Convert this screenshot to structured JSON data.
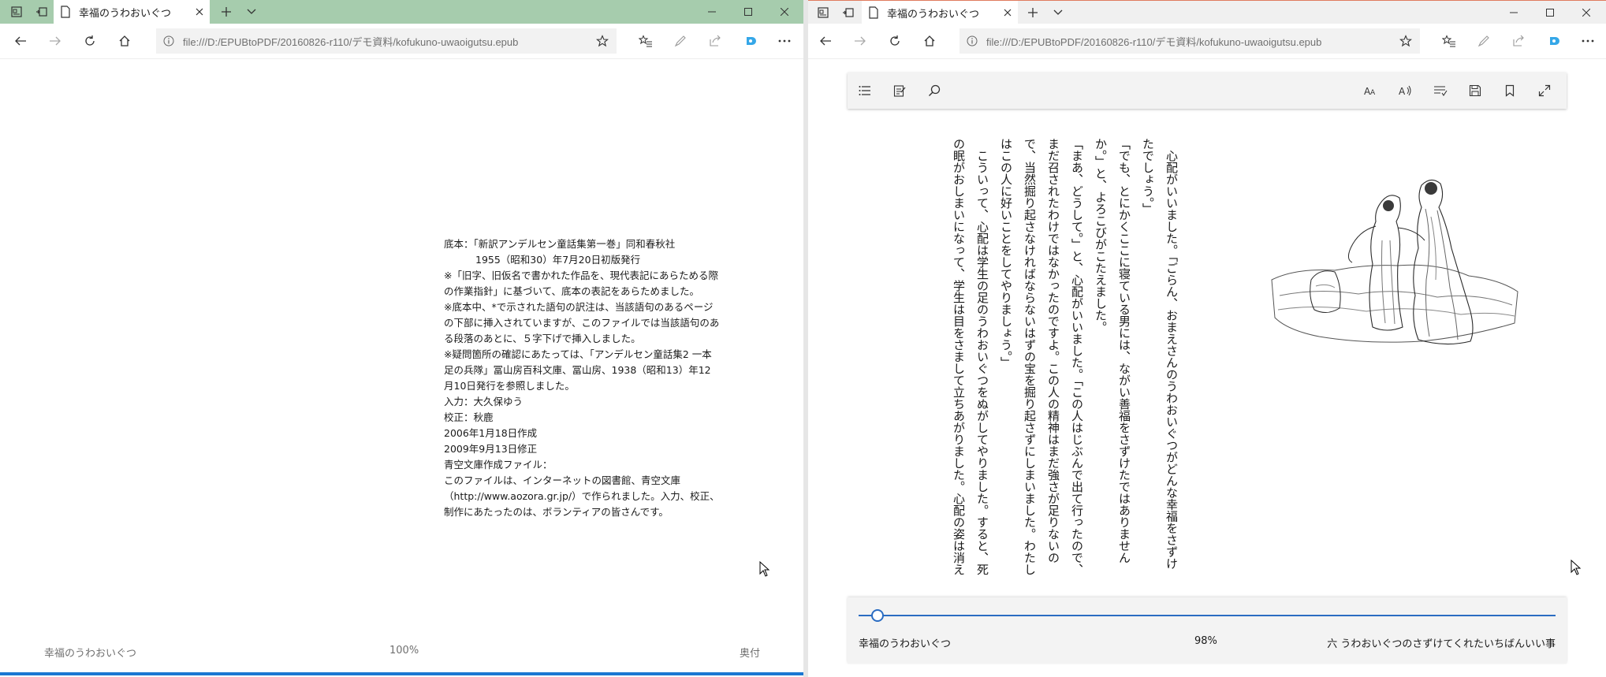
{
  "left_window": {
    "tab_title": "幸福のうわおいぐつ",
    "address": "file:///D:/EPUBtoPDF/20160826-r110/デモ資料/kofukuno-uwaoigutsu.epub",
    "colophon": [
      "底本：「新訳アンデルセン童話集第一巻」同和春秋社",
      "1955（昭和30）年7月20日初版発行",
      "※「旧字、旧仮名で書かれた作品を、現代表記にあらためる際の作業指針」に基づいて、底本の表記をあらためました。",
      "※底本中、*で示された語句の訳注は、当該語句のあるページの下部に挿入されていますが、このファイルでは当該語句のある段落のあとに、５字下げで挿入しました。",
      "※疑問箇所の確認にあたっては、「アンデルセン童話集2 一本足の兵隊」冨山房百科文庫、冨山房、1938（昭和13）年12月10日発行を参照しました。",
      "入力：大久保ゆう",
      "校正：秋鹿",
      "2006年1月18日作成",
      "2009年9月13日修正",
      "青空文庫作成ファイル：",
      "このファイルは、インターネットの図書館、青空文庫（http://www.aozora.gr.jp/）で作られました。入力、校正、制作にあたったのは、ボランティアの皆さんです。"
    ],
    "footer": {
      "book_title": "幸福のうわおいぐつ",
      "progress": "100%",
      "section": "奥付"
    },
    "progress_value": 1.0
  },
  "right_window": {
    "tab_title": "幸福のうわおいぐつ",
    "address": "file:///D:/EPUBtoPDF/20160826-r110/デモ資料/kofukuno-uwaoigutsu.epub",
    "paragraphs": [
      "心配がいいました。「ごらん、おまえさんのうわおいぐつがどんな幸福をさずけたでしょう。」",
      "「でも、とにかくここに寝ている男には、ながい善福をさずけたではありませんか。」と、よろこびがこたえました。",
      "「まあ、どうして。」と、心配がいいました。「この人はじぶんで出て行ったので、まだ召されたわけではなかったのですよ。この人の精神はまだ強さが足りないので、当然掘り起さなければならないはずの宝を掘り起さずにしまいました。わたしはこの人に好いことをしてやりましょう。」",
      "こういって、心配は学生の足のうわおいぐつをぬがしてやりました。すると、死の眠がおしまいになって、学生は目をさまして立ちあがりました。心配の姿は消えました。それといっしょにうわおいぐつも消えてなくなりました。――きっと心配が、そののちそれをじぶんの物にして、もっているのでしょう。"
    ],
    "footer": {
      "book_title": "幸福のうわおいぐつ",
      "progress": "98%",
      "chapter": "六 うわおいぐつのさずけてくれたいちばんいい事"
    },
    "progress_value": 0.98
  },
  "icons": {
    "tab_list": "tab-list-icon",
    "tab_aside": "tabs-aside-icon",
    "page": "page-icon",
    "close": "close-icon",
    "new_tab": "plus-icon",
    "tab_dropdown": "chevron-down-icon",
    "minimize": "minimize-icon",
    "maximize": "maximize-icon",
    "back": "back-arrow-icon",
    "forward": "forward-arrow-icon",
    "refresh": "refresh-icon",
    "home": "home-icon",
    "info": "info-icon",
    "favorite": "star-icon",
    "favorites": "favorites-icon",
    "notes": "pen-icon",
    "share": "share-icon",
    "extension": "extension-icon",
    "more": "more-icon",
    "toc": "list-icon",
    "notes_panel": "notes-icon",
    "search": "search-icon",
    "text_options": "text-size-icon",
    "read_aloud": "read-aloud-icon",
    "grammar": "grammar-icon",
    "save": "save-icon",
    "bookmark": "bookmark-icon",
    "fullscreen": "fullscreen-icon"
  },
  "colors": {
    "accent": "#1b77d2",
    "left_tabbar": "#a6ccad",
    "right_tabbar": "#f0f0f0",
    "slider": "#2a6cc2"
  }
}
